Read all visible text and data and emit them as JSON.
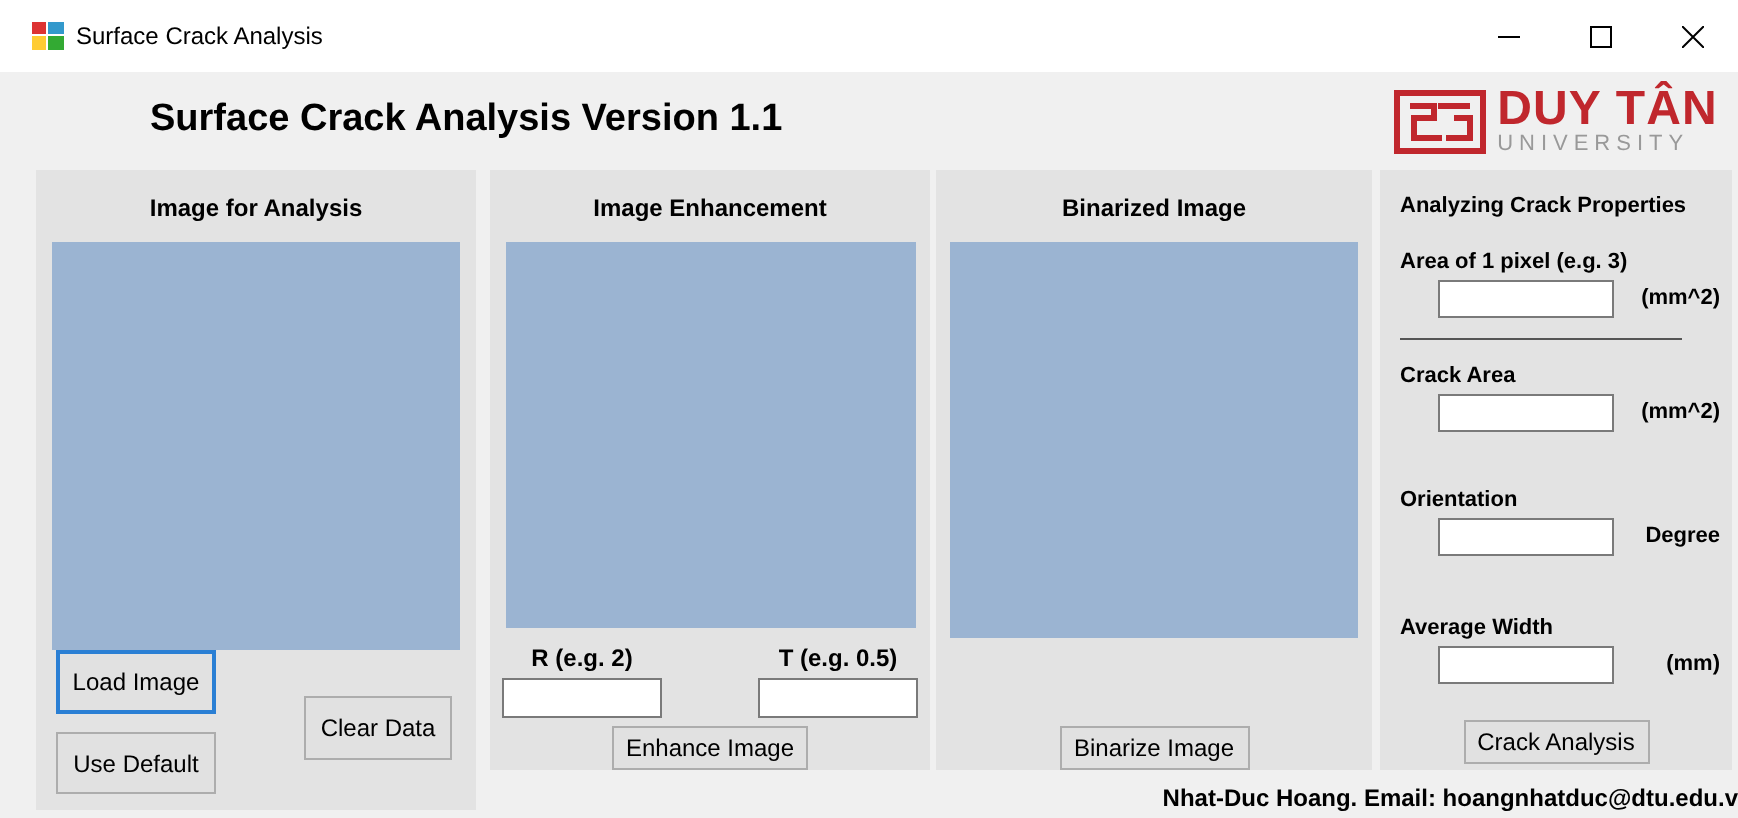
{
  "window": {
    "title": "Surface Crack Analysis"
  },
  "header": {
    "title": "Surface Crack Analysis Version 1.1",
    "logo_name": "DUY TÂN",
    "logo_sub": "UNIVERSITY"
  },
  "analysis_panel": {
    "title": "Image for Analysis",
    "buttons": [
      {
        "label": "Load Image",
        "focused": true
      },
      {
        "label": "Use Default",
        "focused": false
      },
      {
        "label": "Clear Data",
        "focused": false
      }
    ]
  },
  "enhancement_panel": {
    "title": "Image Enhancement",
    "fields": [
      {
        "label": "R (e.g. 2)"
      },
      {
        "label": "T (e.g. 0.5)"
      }
    ],
    "button": "Enhance Image"
  },
  "binarized_panel": {
    "title": "Binarized Image",
    "button": "Binarize Image"
  },
  "properties_panel": {
    "title": "Analyzing Crack Properties",
    "fields": [
      {
        "label": "Area of 1 pixel (e.g. 3)",
        "unit": "(mm^2)",
        "rule_after": true
      },
      {
        "label": "Crack Area",
        "unit": "(mm^2)",
        "rule_after": false
      },
      {
        "label": "Orientation",
        "unit": "Degree",
        "rule_after": false
      },
      {
        "label": "Average Width",
        "unit": "(mm)",
        "rule_after": false
      }
    ],
    "button": "Crack Analysis"
  },
  "footer": "Nhat-Duc Hoang. Email: hoangnhatduc@dtu.edu.v"
}
